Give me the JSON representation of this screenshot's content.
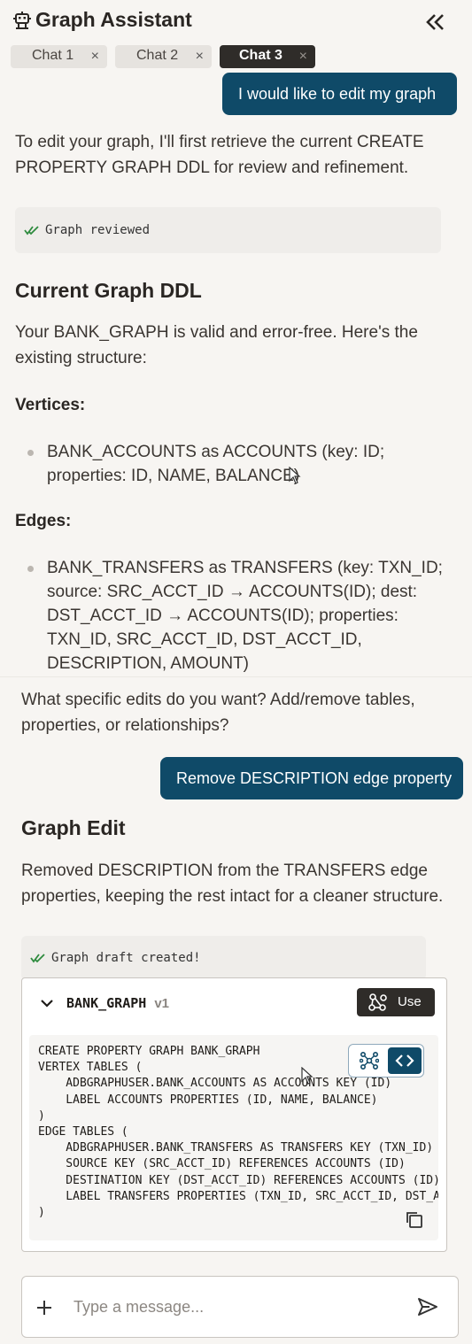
{
  "header": {
    "title": "Graph Assistant"
  },
  "tabs": [
    {
      "label": "Chat 1",
      "active": false
    },
    {
      "label": "Chat 2",
      "active": false
    },
    {
      "label": "Chat 3",
      "active": true
    }
  ],
  "messages": {
    "user_1": "I would like to edit my graph",
    "assistant_1": {
      "intro": "To edit your graph, I'll first retrieve the current CREATE PROPERTY GRAPH DDL for review and refinement.",
      "status": "Graph reviewed",
      "heading": "Current Graph DDL",
      "summary": "Your BANK_GRAPH is valid and error-free. Here's the existing structure:",
      "vertices_label": "Vertices:",
      "vertex_item": "BANK_ACCOUNTS as ACCOUNTS (key: ID; properties: ID, NAME, BALANCE)",
      "edges_label": "Edges:",
      "edge_item": "BANK_TRANSFERS as TRANSFERS (key: TXN_ID; source: SRC_ACCT_ID → ACCOUNTS(ID); dest: DST_ACCT_ID → ACCOUNTS(ID); properties: TXN_ID, SRC_ACCT_ID, DST_ACCT_ID, DESCRIPTION, AMOUNT)",
      "question": "What specific edits do you want? Add/remove tables, properties, or relationships?"
    },
    "user_2": "Remove DESCRIPTION edge property",
    "assistant_2": {
      "heading": "Graph Edit",
      "summary": "Removed DESCRIPTION from the TRANSFERS edge properties, keeping the rest intact for a cleaner structure.",
      "status": "Graph draft created!"
    }
  },
  "graph_card": {
    "name": "BANK_GRAPH",
    "version": "v1",
    "use_label": "Use",
    "ddl": "CREATE PROPERTY GRAPH BANK_GRAPH\nVERTEX TABLES (\n    ADBGRAPHUSER.BANK_ACCOUNTS AS ACCOUNTS KEY (ID)\n    LABEL ACCOUNTS PROPERTIES (ID, NAME, BALANCE)\n)\nEDGE TABLES (\n    ADBGRAPHUSER.BANK_TRANSFERS AS TRANSFERS KEY (TXN_ID)\n    SOURCE KEY (SRC_ACCT_ID) REFERENCES ACCOUNTS (ID)\n    DESTINATION KEY (DST_ACCT_ID) REFERENCES ACCOUNTS (ID)\n    LABEL TRANSFERS PROPERTIES (TXN_ID, SRC_ACCT_ID, DST_ACCT_ID, AMOUNT)\n)"
  },
  "composer": {
    "placeholder": "Type a message..."
  },
  "icons": {
    "title": "robot-icon",
    "collapse": "double-chevron-left-icon",
    "tab_close": "close-icon",
    "status": "double-check-icon",
    "card_toggle": "chevron-down-icon",
    "use": "graph-icon",
    "view_graph": "graph-icon",
    "view_code": "code-icon",
    "copy": "copy-icon",
    "attach": "plus-icon",
    "send": "send-icon"
  },
  "colors": {
    "accent": "#0f4a68",
    "dark": "#2f2c29",
    "success": "#2e8b3e",
    "background": "#f7f5f2"
  }
}
